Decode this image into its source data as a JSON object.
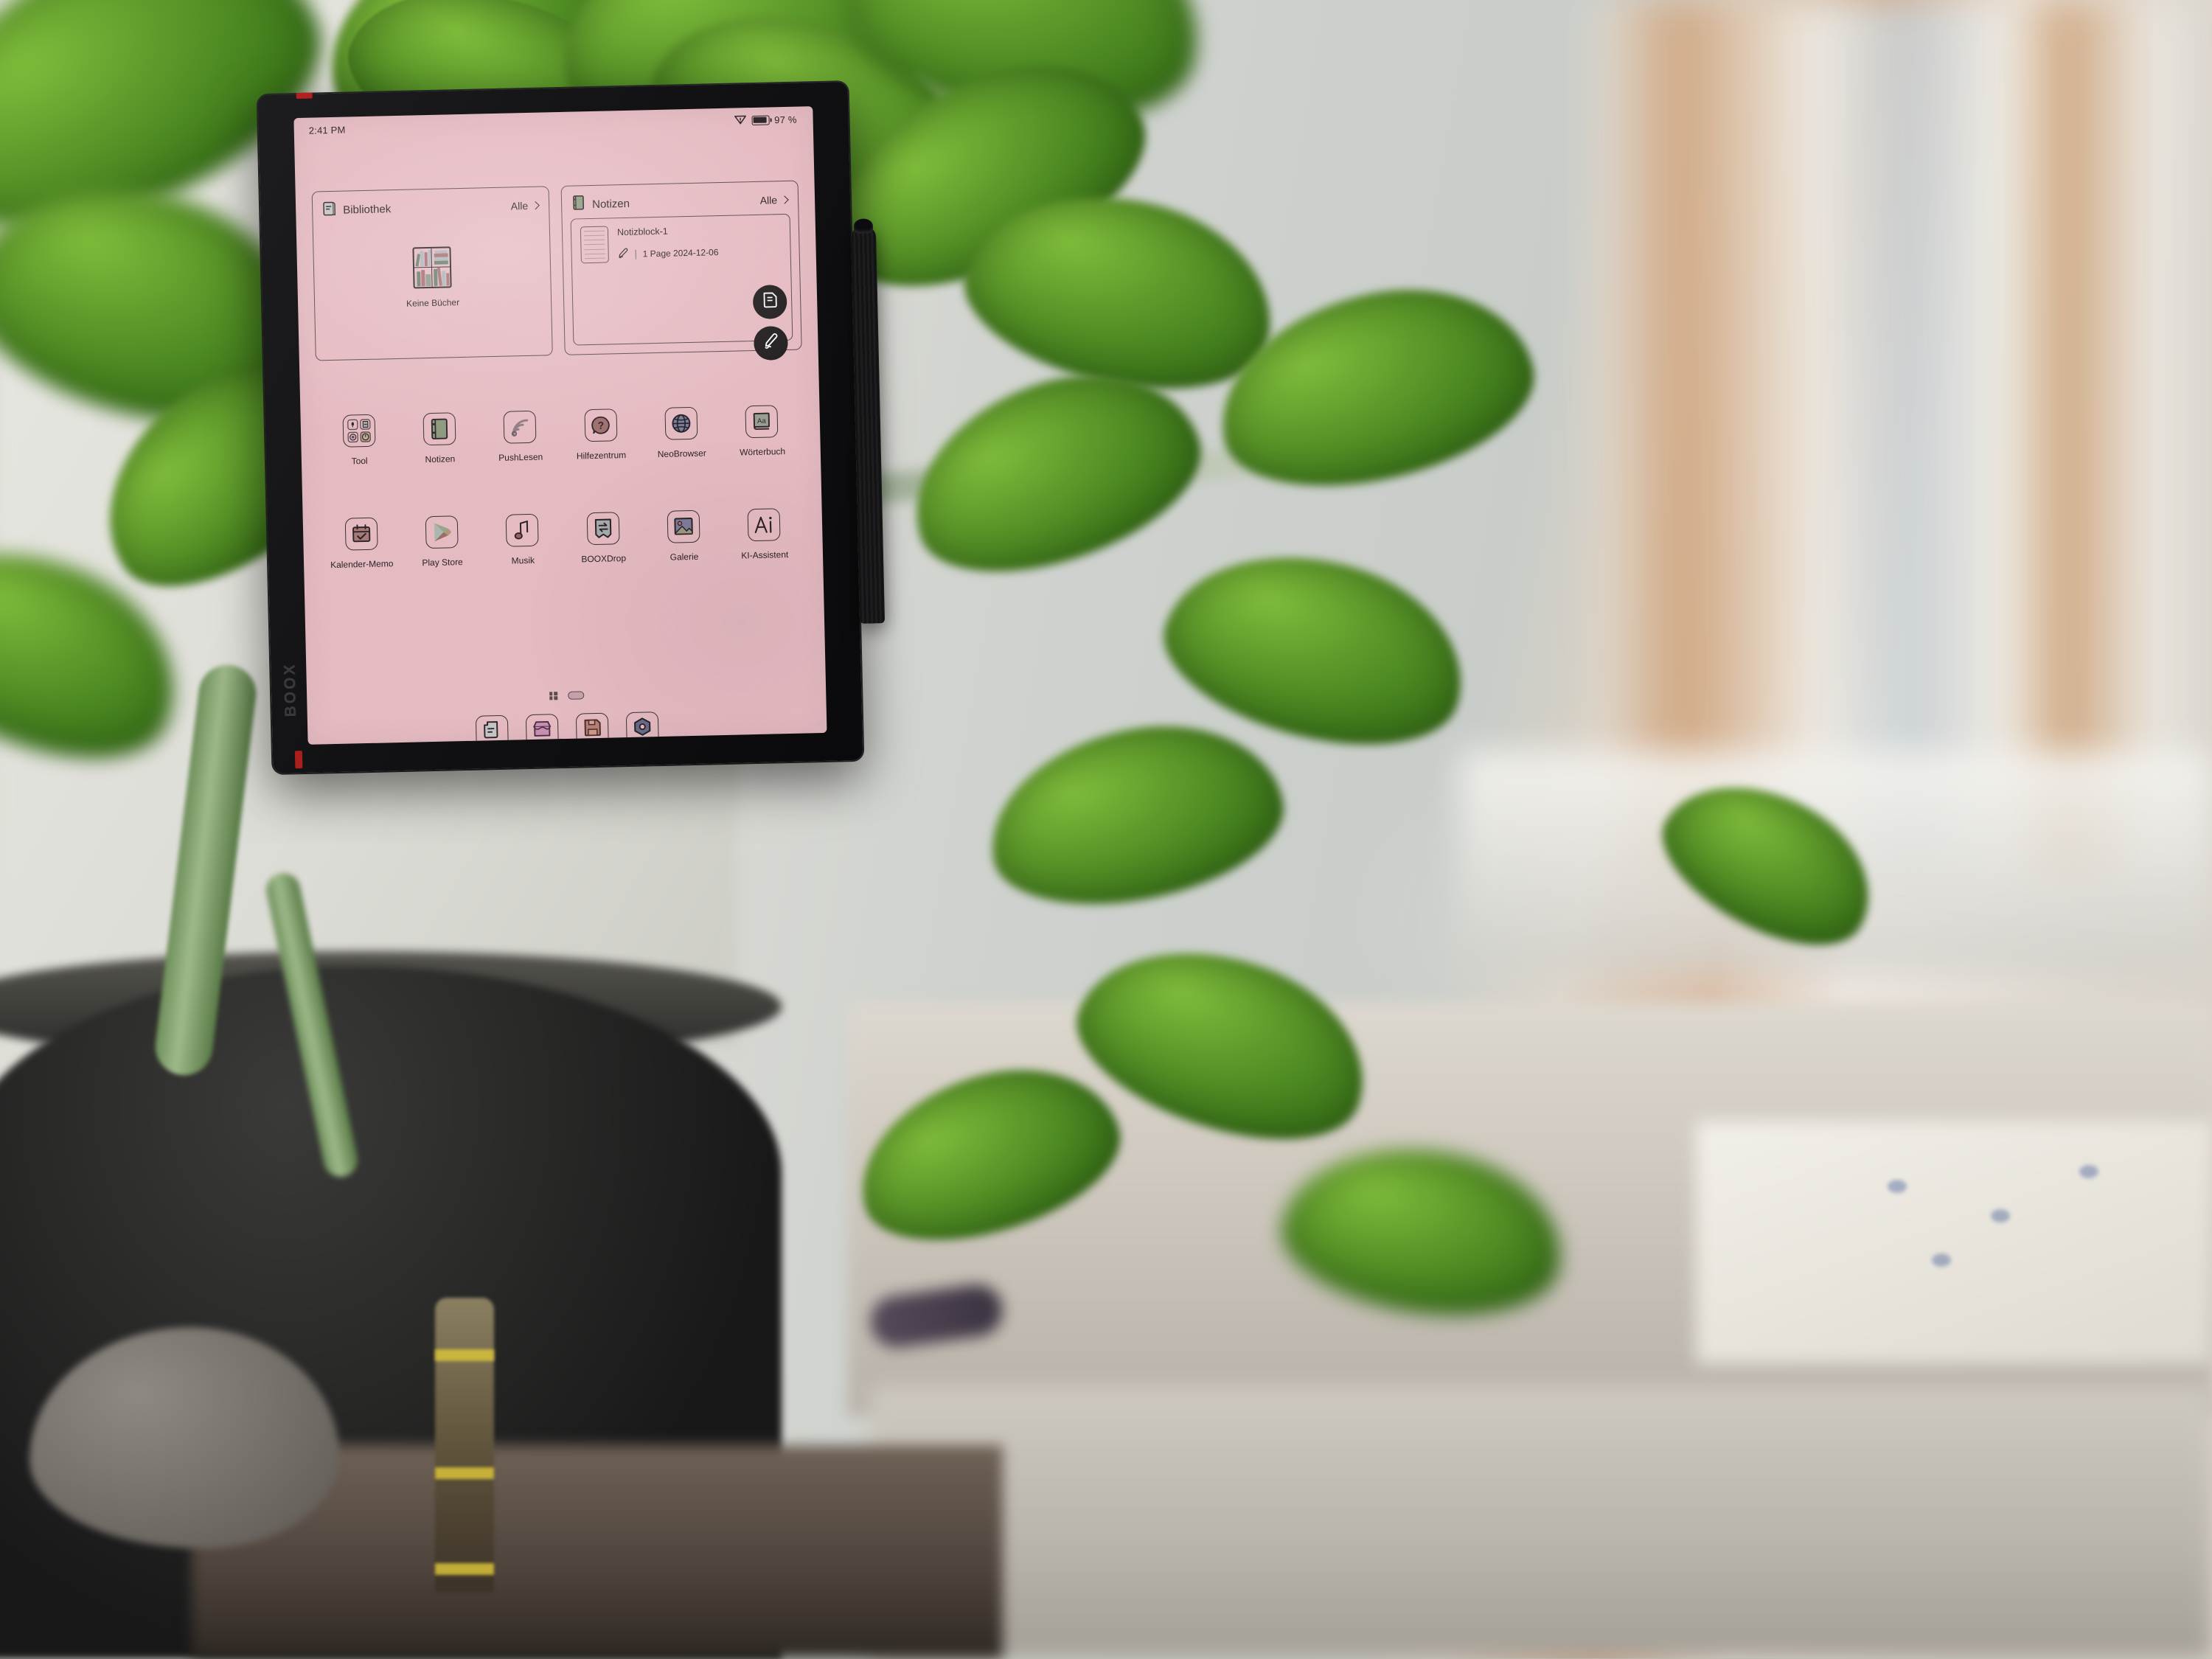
{
  "device": {
    "brand": "BOOX",
    "screen_bg": "#e7bcc3",
    "ink_color": "#2b2327"
  },
  "statusbar": {
    "time": "2:41 PM",
    "wifi_icon": "wifi-disconnected-icon",
    "battery_icon": "battery-icon",
    "battery_level": "97 %"
  },
  "cards": [
    {
      "id": "bibliothek",
      "icon": "library-book-icon",
      "title": "Bibliothek",
      "all_label": "Alle",
      "chevron_icon": "chevron-right-icon",
      "empty_icon": "bookshelf-icon",
      "empty_label": "Keine Bücher"
    },
    {
      "id": "notizen",
      "icon": "notebook-icon",
      "title": "Notizen",
      "all_label": "Alle",
      "chevron_icon": "chevron-right-icon",
      "note": {
        "thumb_icon": "note-page-icon",
        "title": "Notizblock-1",
        "pen_icon": "pen-icon",
        "pages": "1 Page",
        "date": "2024-12-06",
        "meta": "1 Page 2024-12-06"
      },
      "fabs": [
        {
          "name": "new-note-button",
          "icon": "document-icon"
        },
        {
          "name": "new-handwriting-button",
          "icon": "pen-icon"
        }
      ]
    }
  ],
  "apps": {
    "row1": [
      {
        "label": "Tool",
        "icon": "tool-folder-icon"
      },
      {
        "label": "Notizen",
        "icon": "notebook-icon"
      },
      {
        "label": "PushLesen",
        "icon": "rss-icon"
      },
      {
        "label": "Hilfezentrum",
        "icon": "help-question-icon"
      },
      {
        "label": "NeoBrowser",
        "icon": "globe-icon"
      },
      {
        "label": "Wörterbuch",
        "icon": "dictionary-aa-icon"
      }
    ],
    "row2": [
      {
        "label": "Kalender-Memo",
        "icon": "calendar-check-icon"
      },
      {
        "label": "Play Store",
        "icon": "play-store-icon"
      },
      {
        "label": "Musik",
        "icon": "music-note-icon"
      },
      {
        "label": "BOOXDrop",
        "icon": "transfer-arrows-icon"
      },
      {
        "label": "Galerie",
        "icon": "image-picture-icon"
      },
      {
        "label": "KI-Assistent",
        "icon": "ai-letters-icon"
      }
    ]
  },
  "pager": {
    "grid_icon": "grid-pages-icon",
    "current_page_icon": "page-pill-indicator"
  },
  "dock": [
    {
      "name": "dock-library",
      "icon": "document-stack-icon"
    },
    {
      "name": "dock-store",
      "icon": "storefront-icon"
    },
    {
      "name": "dock-storage",
      "icon": "floppy-save-icon"
    },
    {
      "name": "dock-settings",
      "icon": "hex-nut-settings-icon"
    }
  ],
  "tool_folder_items": [
    "microphone-icon",
    "calculator-icon",
    "record-icon",
    "clock-icon"
  ]
}
